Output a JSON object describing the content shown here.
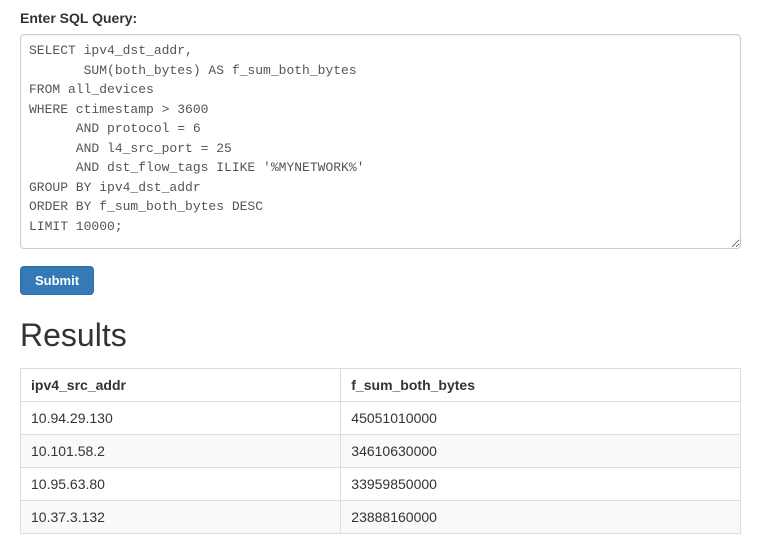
{
  "form": {
    "label": "Enter SQL Query:",
    "query": "SELECT ipv4_dst_addr,\n       SUM(both_bytes) AS f_sum_both_bytes\nFROM all_devices\nWHERE ctimestamp > 3600\n      AND protocol = 6\n      AND l4_src_port = 25\n      AND dst_flow_tags ILIKE '%MYNETWORK%'\nGROUP BY ipv4_dst_addr\nORDER BY f_sum_both_bytes DESC\nLIMIT 10000;",
    "submit_label": "Submit"
  },
  "results": {
    "heading": "Results",
    "columns": [
      "ipv4_src_addr",
      "f_sum_both_bytes"
    ],
    "rows": [
      {
        "ipv4_src_addr": "10.94.29.130",
        "f_sum_both_bytes": "45051010000"
      },
      {
        "ipv4_src_addr": "10.101.58.2",
        "f_sum_both_bytes": "34610630000"
      },
      {
        "ipv4_src_addr": "10.95.63.80",
        "f_sum_both_bytes": "33959850000"
      },
      {
        "ipv4_src_addr": "10.37.3.132",
        "f_sum_both_bytes": "23888160000"
      }
    ]
  }
}
